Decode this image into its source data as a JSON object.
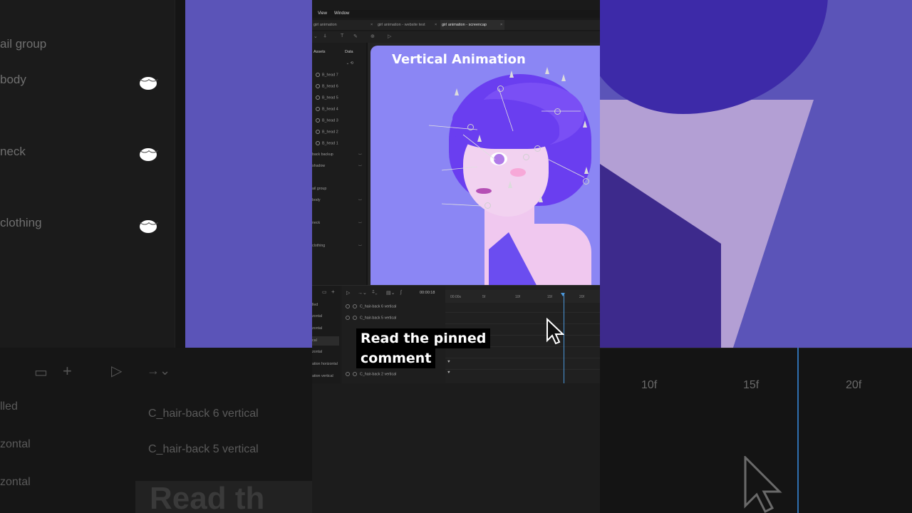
{
  "menubar": {
    "view": "View",
    "window": "Window"
  },
  "tabs": [
    {
      "label": "girl animation",
      "close": "×"
    },
    {
      "label": "girl animation - website test",
      "close": "×"
    },
    {
      "label": "girl animation - screencap",
      "close": "×"
    }
  ],
  "sidebar": {
    "tab_assets": "Assets",
    "tab_data": "Data",
    "layers": [
      "B_head 7",
      "B_head 6",
      "B_head 5",
      "B_head 4",
      "B_head 3",
      "B_head 2",
      "B_head 1"
    ],
    "groups": [
      "back backup",
      "shadow",
      "ail group",
      "body",
      "neck",
      "clothing"
    ]
  },
  "canvas": {
    "title": "Vertical Animation"
  },
  "timeline": {
    "time": "00:00:18",
    "left_rows": [
      "lled",
      "zontal",
      "zontal",
      "cal",
      "zontal",
      "ation horizontal",
      "ation vertical"
    ],
    "tracks": [
      "C_hair-back 6 vertical",
      "C_hair-back 5 vertical",
      "C_hair-back 2 vertical"
    ],
    "ticks": [
      "00:00s",
      "5f",
      "10f",
      "15f",
      "20f"
    ]
  },
  "caption": {
    "line1": "Read the pinned",
    "line2": "comment"
  },
  "background": {
    "left_labels": [
      "ail group",
      "body",
      "neck",
      "clothing"
    ],
    "left_tracks": [
      "lled",
      "zontal",
      "zontal"
    ],
    "tracks": [
      "C_hair-back 6 vertical",
      "C_hair-back 5 vertical"
    ],
    "ticks": [
      "10f",
      "15f",
      "20f"
    ],
    "ghost_text": "Read th"
  },
  "colors": {
    "accent": "#4b96d8",
    "canvas": "#8b86f4",
    "hair": "#6a3ef0"
  }
}
